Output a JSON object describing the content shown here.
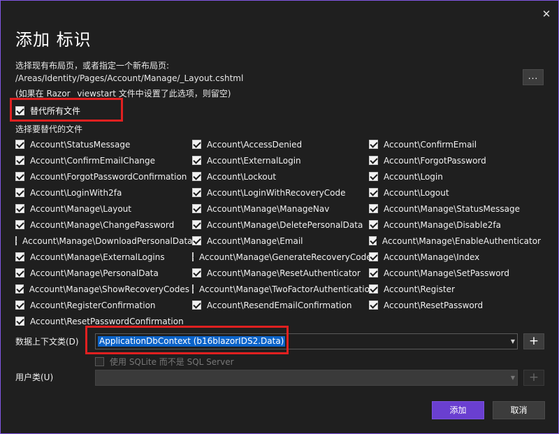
{
  "window": {
    "close_icon": "close-icon"
  },
  "title": "添加 标识",
  "layout_section": {
    "prompt": "选择现有布局页，或者指定一个新布局页:",
    "path": "/Areas/Identity/Pages/Account/Manage/_Layout.cshtml",
    "hint": "(如果在 Razor _viewstart 文件中设置了此选项，则留空)",
    "browse_label": "..."
  },
  "replace_all": {
    "label": "替代所有文件",
    "checked": true
  },
  "files_section": {
    "heading": "选择要替代的文件",
    "files": [
      "Account\\StatusMessage",
      "Account\\AccessDenied",
      "Account\\ConfirmEmail",
      "Account\\ConfirmEmailChange",
      "Account\\ExternalLogin",
      "Account\\ForgotPassword",
      "Account\\ForgotPasswordConfirmation",
      "Account\\Lockout",
      "Account\\Login",
      "Account\\LoginWith2fa",
      "Account\\LoginWithRecoveryCode",
      "Account\\Logout",
      "Account\\Manage\\Layout",
      "Account\\Manage\\ManageNav",
      "Account\\Manage\\StatusMessage",
      "Account\\Manage\\ChangePassword",
      "Account\\Manage\\DeletePersonalData",
      "Account\\Manage\\Disable2fa",
      "Account\\Manage\\DownloadPersonalData",
      "Account\\Manage\\Email",
      "Account\\Manage\\EnableAuthenticator",
      "Account\\Manage\\ExternalLogins",
      "Account\\Manage\\GenerateRecoveryCodes",
      "Account\\Manage\\Index",
      "Account\\Manage\\PersonalData",
      "Account\\Manage\\ResetAuthenticator",
      "Account\\Manage\\SetPassword",
      "Account\\Manage\\ShowRecoveryCodes",
      "Account\\Manage\\TwoFactorAuthentication",
      "Account\\Register",
      "Account\\RegisterConfirmation",
      "Account\\ResendEmailConfirmation",
      "Account\\ResetPassword",
      "Account\\ResetPasswordConfirmation"
    ]
  },
  "data_context": {
    "label": "数据上下文类(D)",
    "value": "ApplicationDbContext (b16blazorIDS2.Data)",
    "add_label": "+"
  },
  "sqlite_option": {
    "label": "使用 SQLite 而不是 SQL Server",
    "checked": false
  },
  "user_class": {
    "label": "用户类(U)",
    "value": "",
    "add_label": "+"
  },
  "buttons": {
    "add": "添加",
    "cancel": "取消"
  },
  "colors": {
    "accent": "#6a3fd0",
    "highlight_box": "#e02020",
    "selection": "#0b63c9"
  }
}
